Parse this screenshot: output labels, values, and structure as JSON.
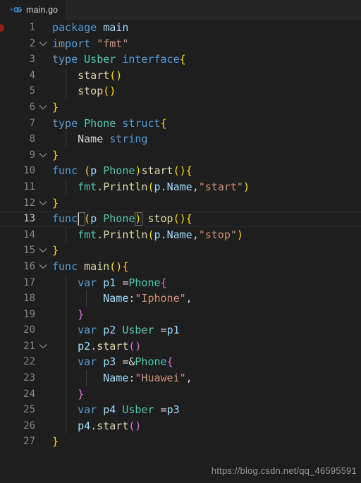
{
  "window": {
    "background_color": "#1e1e1e",
    "tabbar_color": "#252526"
  },
  "tabbar": {
    "active_tab": {
      "label": "main.go",
      "icon": "go-language-icon",
      "icon_color": "#3b82c4"
    }
  },
  "editor": {
    "language": "go",
    "active_line": 13,
    "breakpoint_line": 1,
    "breakpoint_color": "#8b1f1a",
    "cursor": {
      "line": 13,
      "column": 6
    },
    "colors": {
      "keyword": "#569cd6",
      "type": "#4ec9b0",
      "function": "#dcdcaa",
      "string": "#ce9178",
      "variable": "#9cdcfe",
      "plain": "#d4d4d4",
      "line_number": "#858585",
      "bracket_1": "#ffd700",
      "bracket_2": "#da70d6",
      "bracket_3": "#179fff"
    },
    "lines": [
      {
        "n": "1",
        "text": "package main"
      },
      {
        "n": "2",
        "text": "import \"fmt\""
      },
      {
        "n": "3",
        "text": "type Usber interface{"
      },
      {
        "n": "4",
        "text": "    start()"
      },
      {
        "n": "5",
        "text": "    stop()"
      },
      {
        "n": "6",
        "text": "}"
      },
      {
        "n": "7",
        "text": "type Phone struct{"
      },
      {
        "n": "8",
        "text": "    Name string"
      },
      {
        "n": "9",
        "text": "}"
      },
      {
        "n": "10",
        "text": "func (p Phone)start(){"
      },
      {
        "n": "11",
        "text": "    fmt.Println(p.Name,\"start\")"
      },
      {
        "n": "12",
        "text": "}"
      },
      {
        "n": "13",
        "text": "func (p Phone) stop(){"
      },
      {
        "n": "14",
        "text": "    fmt.Println(p.Name,\"stop\")"
      },
      {
        "n": "15",
        "text": "}"
      },
      {
        "n": "16",
        "text": "func main(){"
      },
      {
        "n": "17",
        "text": "    var p1 =Phone{"
      },
      {
        "n": "18",
        "text": "        Name:\"Iphone\","
      },
      {
        "n": "19",
        "text": "    }"
      },
      {
        "n": "20",
        "text": "    var p2 Usber =p1"
      },
      {
        "n": "21",
        "text": "    p2.start()"
      },
      {
        "n": "22",
        "text": "    var p3 =&Phone{"
      },
      {
        "n": "23",
        "text": "        Name:\"Huawei\","
      },
      {
        "n": "24",
        "text": "    }"
      },
      {
        "n": "25",
        "text": "    var p4 Usber =p3"
      },
      {
        "n": "26",
        "text": "    p4.start()"
      },
      {
        "n": "27",
        "text": "}"
      }
    ],
    "line_numbers": [
      "1",
      "2",
      "3",
      "4",
      "5",
      "6",
      "7",
      "8",
      "9",
      "10",
      "11",
      "12",
      "13",
      "14",
      "15",
      "16",
      "17",
      "18",
      "19",
      "20",
      "21",
      "22",
      "23",
      "24",
      "25",
      "26",
      "27"
    ],
    "fold_markers": [
      3,
      7,
      10,
      13,
      16,
      17,
      22
    ]
  },
  "watermark": {
    "text": "https://blog.csdn.net/qq_46595591"
  }
}
